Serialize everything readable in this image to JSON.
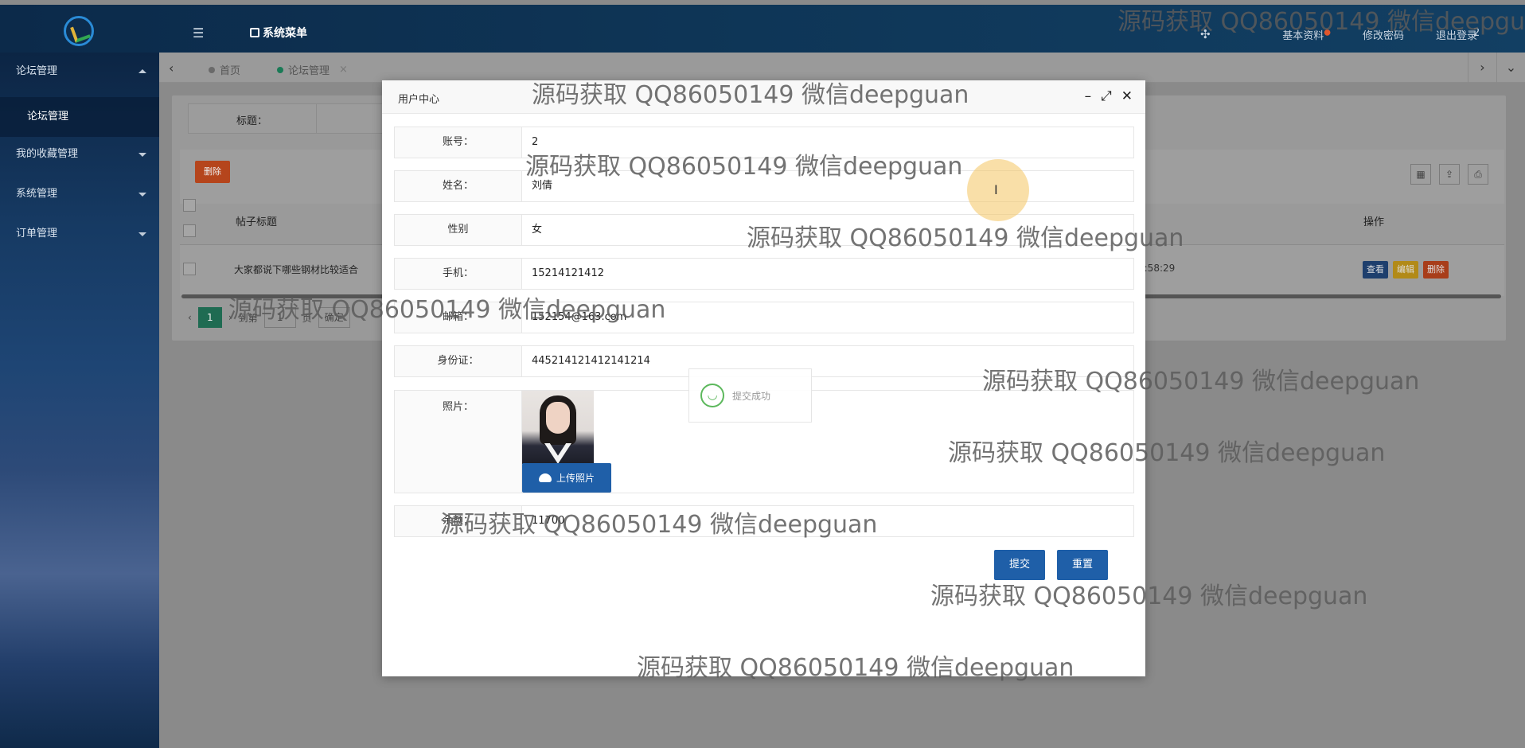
{
  "header": {
    "menu_toggle_icon": "list-icon",
    "system_menu": "系统菜单",
    "nav": [
      "基本资料",
      "修改密码",
      "退出登录"
    ],
    "user": "2"
  },
  "sidebar": {
    "items": [
      {
        "label": "论坛管理",
        "expanded": true
      },
      {
        "label": "我的收藏管理"
      },
      {
        "label": "系统管理"
      },
      {
        "label": "订单管理"
      }
    ],
    "sub_item": "论坛管理"
  },
  "tabs": [
    {
      "label": "首页"
    },
    {
      "label": "论坛管理",
      "active": true
    }
  ],
  "background": {
    "search_label": "标题：",
    "delete_button": "删除",
    "col_title": "帖子标题",
    "col_actions": "操作",
    "row": {
      "title": "大家都说下哪些钢材比较适合",
      "time": "5:58:29",
      "view": "查看",
      "edit": "编辑",
      "delete": "删除"
    },
    "pager": {
      "current": "1",
      "goto": "到第",
      "page_value": "1",
      "page_unit": "页",
      "confirm": "确定"
    }
  },
  "modal": {
    "title": "用户中心",
    "fields": [
      {
        "label": "账号：",
        "value": "2"
      },
      {
        "label": "姓名：",
        "value": "刘倩"
      },
      {
        "label": "性别",
        "value": "女"
      },
      {
        "label": "手机：",
        "value": "15214121412"
      },
      {
        "label": "邮箱：",
        "value": "152154@163.com"
      },
      {
        "label": "身份证：",
        "value": "445214121412141214"
      }
    ],
    "photo_label": "照片：",
    "upload_button": "上传照片",
    "balance_label": "余额：",
    "balance_value": "11700",
    "toast": "提交成功",
    "submit": "提交",
    "reset": "重置"
  },
  "watermark": "源码获取 QQ86050149 微信deepguan"
}
